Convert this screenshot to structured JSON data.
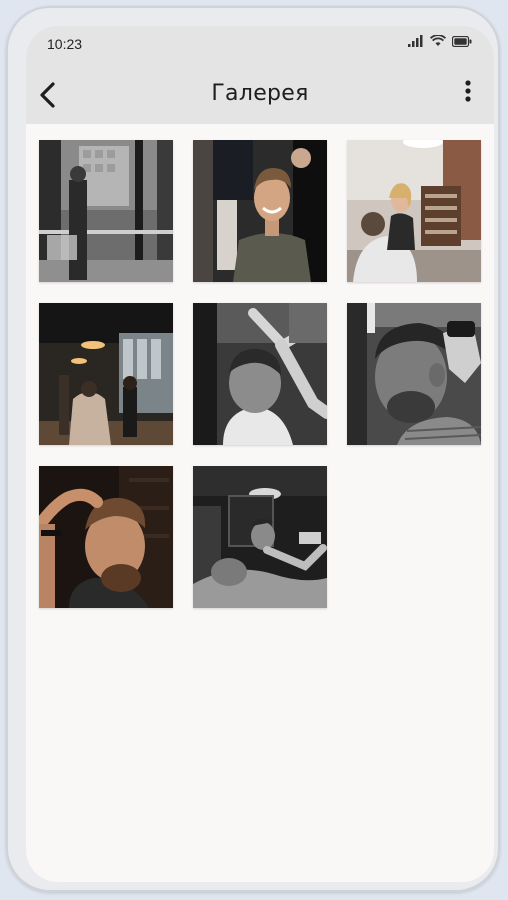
{
  "status": {
    "time": "10:23",
    "icons": [
      "signal-icon",
      "wifi-icon",
      "battery-icon"
    ]
  },
  "appbar": {
    "title": "Галерея",
    "back_icon": "chevron-left-icon",
    "menu_icon": "more-vertical-icon"
  },
  "gallery": {
    "photos": [
      {
        "description_icon": "photo-street-window"
      },
      {
        "description_icon": "photo-smiling-man"
      },
      {
        "description_icon": "photo-salon-hairdresser"
      },
      {
        "description_icon": "photo-barbershop-interior"
      },
      {
        "description_icon": "photo-haircut-bw"
      },
      {
        "description_icon": "photo-trimming-side"
      },
      {
        "description_icon": "photo-styling-hair"
      },
      {
        "description_icon": "photo-shave-bw"
      }
    ]
  }
}
